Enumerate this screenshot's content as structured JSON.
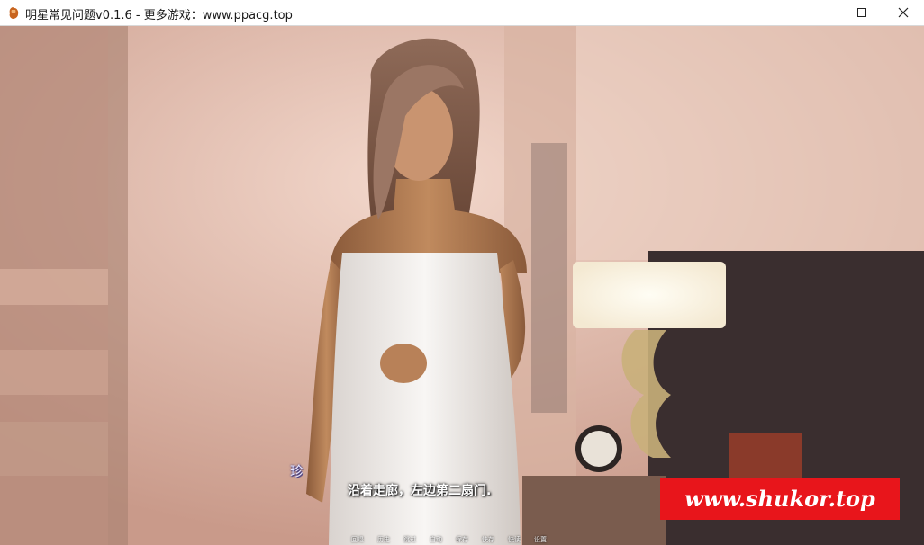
{
  "window": {
    "title": "明星常见问题v0.1.6 - 更多游戏：www.ppacg.top",
    "icon": "app-icon",
    "controls": [
      "minimize-icon",
      "maximize-icon",
      "close-icon"
    ]
  },
  "dialogue": {
    "speaker": "珍",
    "text": "沿着走廊，左边第二扇门."
  },
  "quick_menu": [
    "回退",
    "历史",
    "跳过",
    "自动",
    "保存",
    "快存",
    "快读",
    "设置"
  ],
  "watermark": {
    "text": "www.shukor.top",
    "color": "#e8151b"
  }
}
